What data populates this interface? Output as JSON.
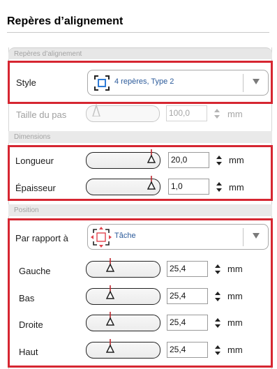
{
  "panel": {
    "title": "Repères d’alignement"
  },
  "sections": {
    "reperes": "Repères d’alignement",
    "dimensions": "Dimensions",
    "position": "Position"
  },
  "style": {
    "label": "Style",
    "value": "4 repères, Type 2"
  },
  "taille_pas": {
    "label": "Taille du pas",
    "value": "100,0",
    "unit": "mm",
    "level": 0.0
  },
  "longueur": {
    "label": "Longueur",
    "value": "20,0",
    "unit": "mm",
    "level": 1.0
  },
  "epaisseur": {
    "label": "Épaisseur",
    "value": "1,0",
    "unit": "mm",
    "level": 1.0
  },
  "par_rapport": {
    "label": "Par rapport à",
    "value": "Tâche"
  },
  "gauche": {
    "label": "Gauche",
    "value": "25,4",
    "unit": "mm",
    "level": 0.25
  },
  "bas": {
    "label": "Bas",
    "value": "25,4",
    "unit": "mm",
    "level": 0.25
  },
  "droite": {
    "label": "Droite",
    "value": "25,4",
    "unit": "mm",
    "level": 0.25
  },
  "haut": {
    "label": "Haut",
    "value": "25,4",
    "unit": "mm",
    "level": 0.25
  },
  "colors": {
    "highlight": "#d62631",
    "accent": "#2b5a9a",
    "marker_red": "#c0282f"
  },
  "icons": {
    "style_icon": "crop-marks-icon",
    "relative_icon": "position-target-icon"
  }
}
